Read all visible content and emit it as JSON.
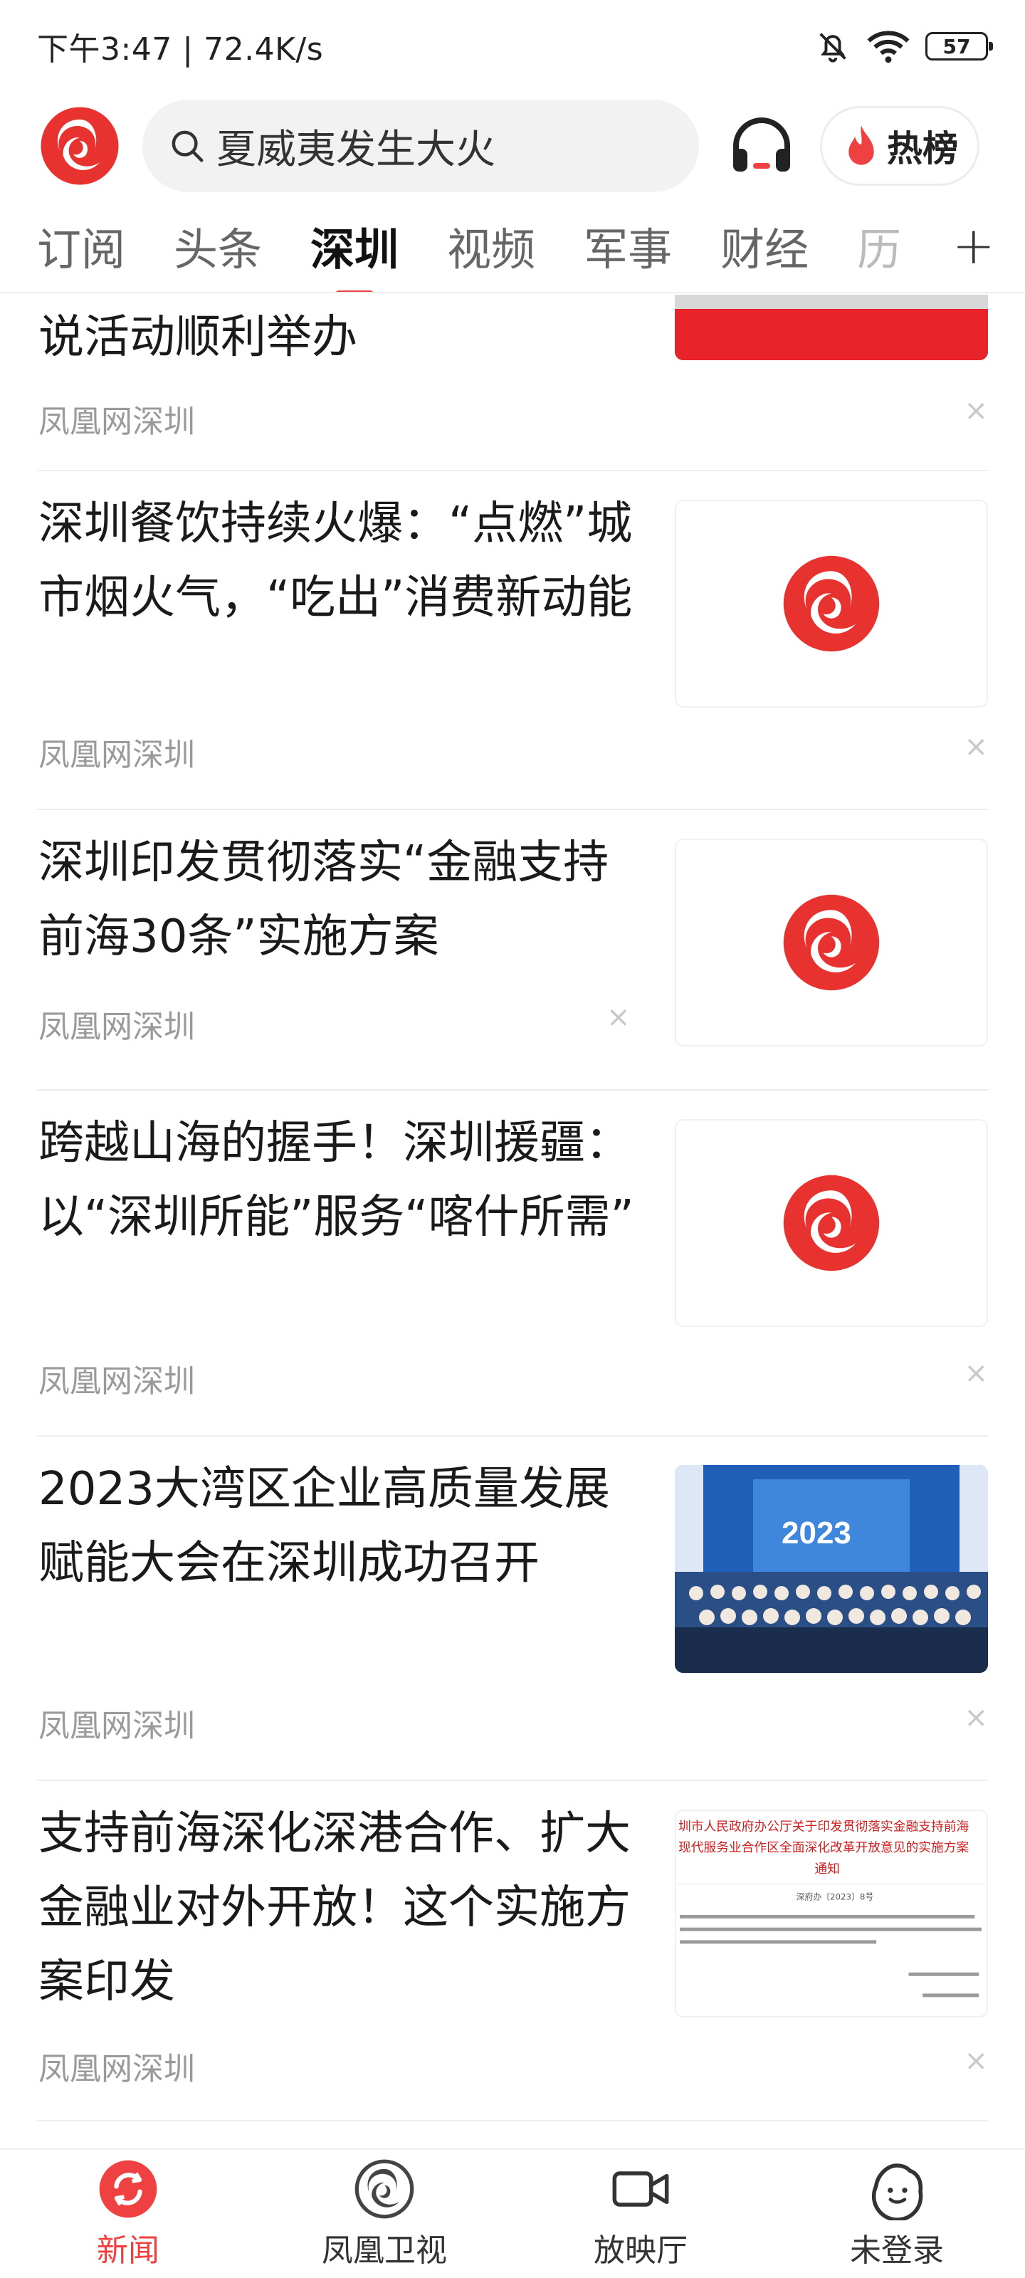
{
  "status_bar": {
    "time_speed": "下午3:47 | 72.4K/s",
    "battery": "57"
  },
  "header": {
    "search_text": "夏威夷发生大火",
    "hot_label": "热榜",
    "icons": [
      "phoenix-logo-icon",
      "search-icon",
      "headphones-icon",
      "flame-icon"
    ]
  },
  "tabs": {
    "items": [
      "订阅",
      "头条",
      "深圳",
      "视频",
      "军事",
      "财经",
      "历"
    ],
    "active": "深圳",
    "add_icon": "+"
  },
  "feed": {
    "items": [
      {
        "title": "说活动顺利举办",
        "source": "凤凰网深圳",
        "thumb": "event-stage-photo"
      },
      {
        "title": "深圳餐饮持续火爆：“点燃”城市烟火气，“吃出”消费新动能",
        "source": "凤凰网深圳",
        "thumb": "phoenix-logo"
      },
      {
        "title": "深圳印发贯彻落实“金融支持前海30条”实施方案",
        "source": "凤凰网深圳",
        "thumb": "phoenix-logo"
      },
      {
        "title": "跨越山海的握手！深圳援疆：以“深圳所能”服务“喀什所需”",
        "source": "凤凰网深圳",
        "thumb": "phoenix-logo"
      },
      {
        "title": "2023大湾区企业高质量发展赋能大会在深圳成功召开",
        "source": "凤凰网深圳",
        "thumb": "group-photo"
      },
      {
        "title": "支持前海深化深港合作、扩大金融业对外开放！这个实施方案印发",
        "source": "凤凰网深圳",
        "thumb": "document-image"
      }
    ],
    "close_icon": "×"
  },
  "thumbs": {
    "banner_year": "2023",
    "doc_title_line1": "圳市人民政府办公厅关于印发贯彻落实金融支持前海",
    "doc_title_line2": "现代服务业合作区全面深化改革开放意见的实施方案",
    "doc_title_line3": "通知",
    "doc_ref": "深府办〔2023〕8号"
  },
  "bottom_nav": {
    "items": [
      {
        "label": "新闻",
        "icon": "news-refresh-icon"
      },
      {
        "label": "凤凰卫视",
        "icon": "phoenix-tv-icon"
      },
      {
        "label": "放映厅",
        "icon": "video-camera-icon"
      },
      {
        "label": "未登录",
        "icon": "user-avatar-icon"
      }
    ],
    "active_index": 0,
    "accent": "#f04142"
  }
}
